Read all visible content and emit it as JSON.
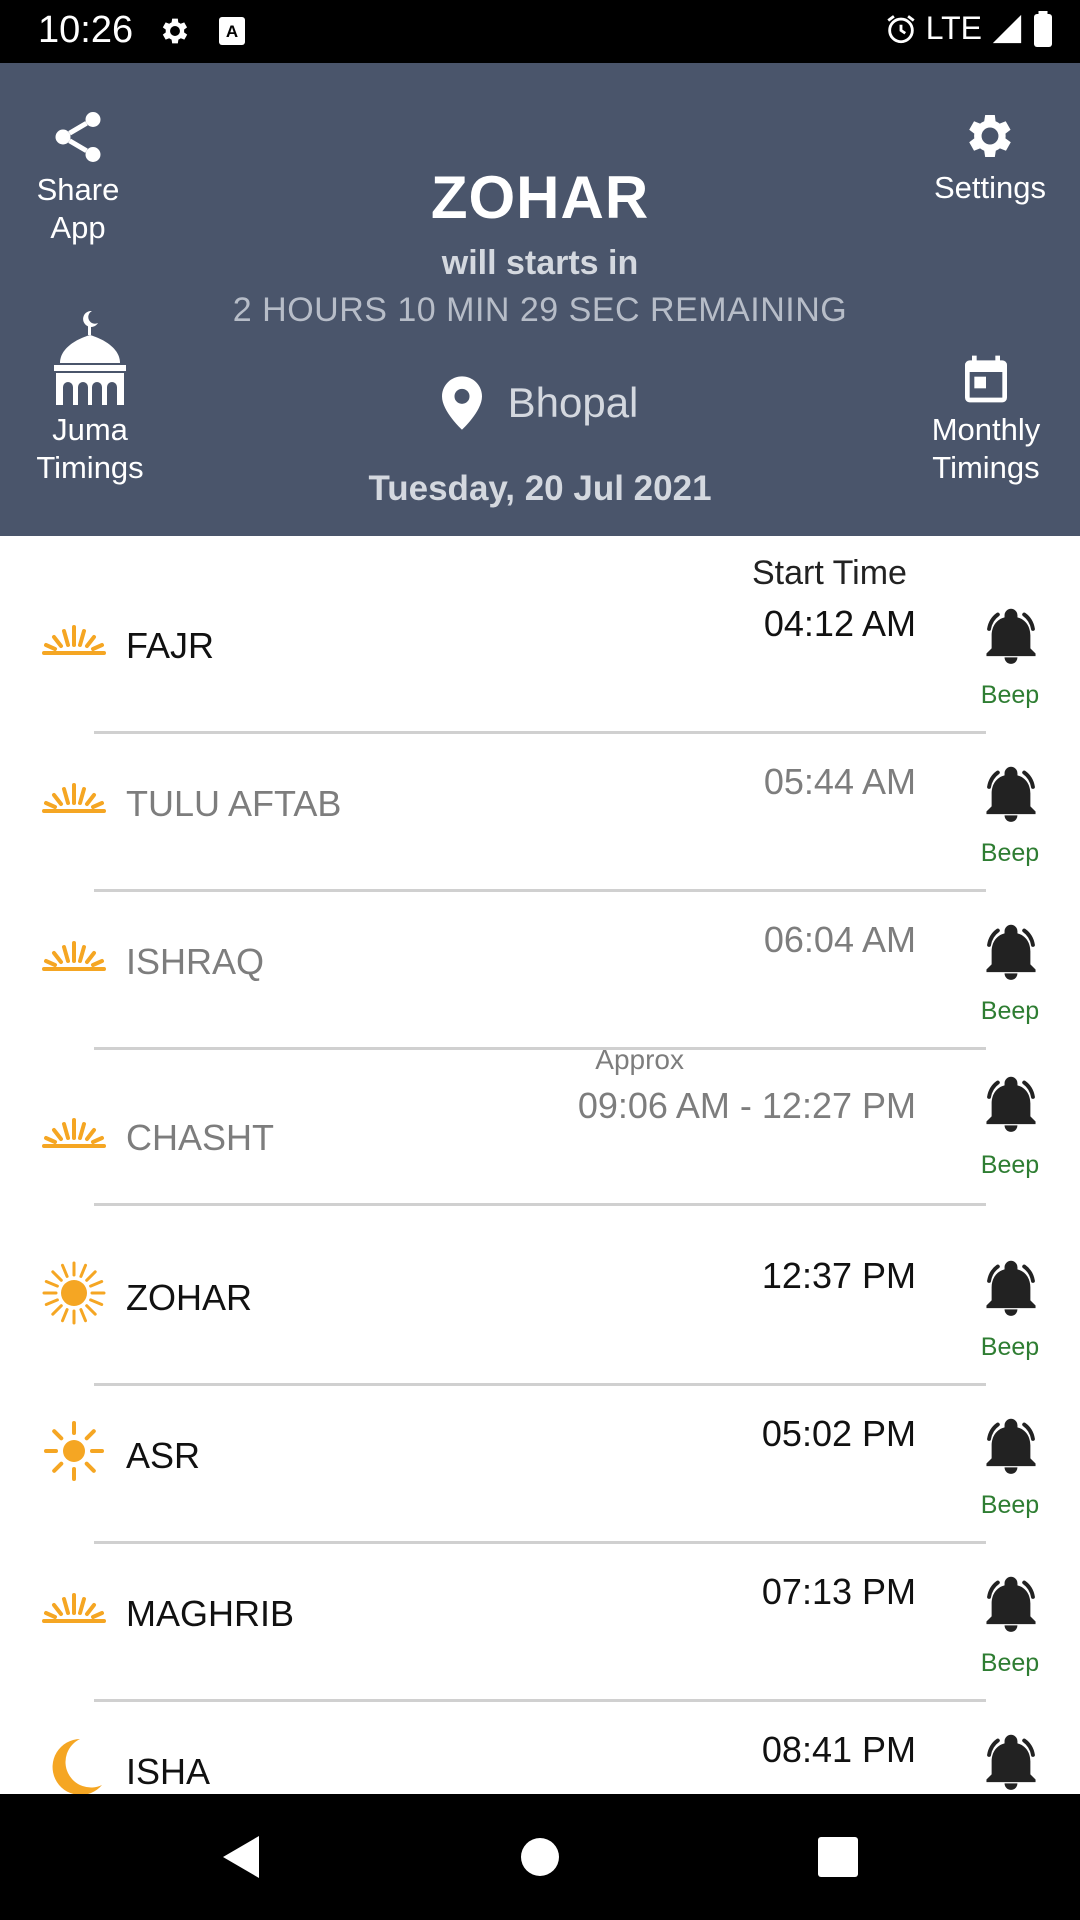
{
  "status_bar": {
    "time": "10:26",
    "network": "LTE"
  },
  "header": {
    "share_label": "Share\nApp",
    "settings_label": "Settings",
    "juma_label": "Juma\nTimings",
    "monthly_label": "Monthly\nTimings",
    "next_prayer": "ZOHAR",
    "starts_in": "will starts in",
    "remaining": "2 HOURS 10 MIN 29 SEC REMAINING",
    "location": "Bhopal",
    "date": "Tuesday, 20 Jul 2021"
  },
  "list": {
    "start_time_header": "Start Time",
    "beep_label": "Beep",
    "prayers": [
      {
        "name": "FAJR",
        "time": "04:12 AM",
        "icon": "sunrise-icon",
        "style": "dark"
      },
      {
        "name": "TULU AFTAB",
        "time": "05:44 AM",
        "icon": "sunrise-icon",
        "style": "muted"
      },
      {
        "name": "ISHRAQ",
        "time": "06:04 AM",
        "icon": "sunrise-icon",
        "style": "muted"
      },
      {
        "name": "CHASHT",
        "time": "09:06 AM - 12:27 PM",
        "approx": "Approx",
        "icon": "sunrise-icon",
        "style": "muted"
      },
      {
        "name": "ZOHAR",
        "time": "12:37 PM",
        "icon": "sun-bright-icon",
        "style": "dark"
      },
      {
        "name": "ASR",
        "time": "05:02 PM",
        "icon": "sun-icon",
        "style": "dark"
      },
      {
        "name": "MAGHRIB",
        "time": "07:13 PM",
        "icon": "sunset-icon",
        "style": "dark"
      },
      {
        "name": "ISHA",
        "time": "08:41 PM",
        "icon": "moon-icon",
        "style": "dark"
      }
    ]
  },
  "colors": {
    "header_bg": "#4a556b",
    "icon_orange": "#f5a623",
    "beep_green": "#2e7d32"
  }
}
